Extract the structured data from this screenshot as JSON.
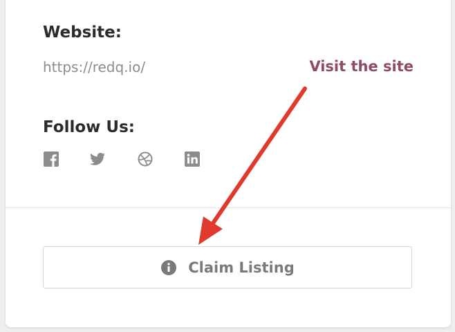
{
  "contact": {
    "website_label": "Website:",
    "website_url": "https://redq.io/",
    "visit_link": "Visit the site",
    "follow_label": "Follow Us:"
  },
  "social_icons": [
    "facebook-icon",
    "twitter-icon",
    "dribbble-icon",
    "linkedin-icon"
  ],
  "claim": {
    "icon": "info-icon",
    "label": "Claim Listing"
  },
  "colors": {
    "link": "#8d4a69",
    "icon": "#8c8c8c",
    "arrow": "#e03a2f"
  }
}
